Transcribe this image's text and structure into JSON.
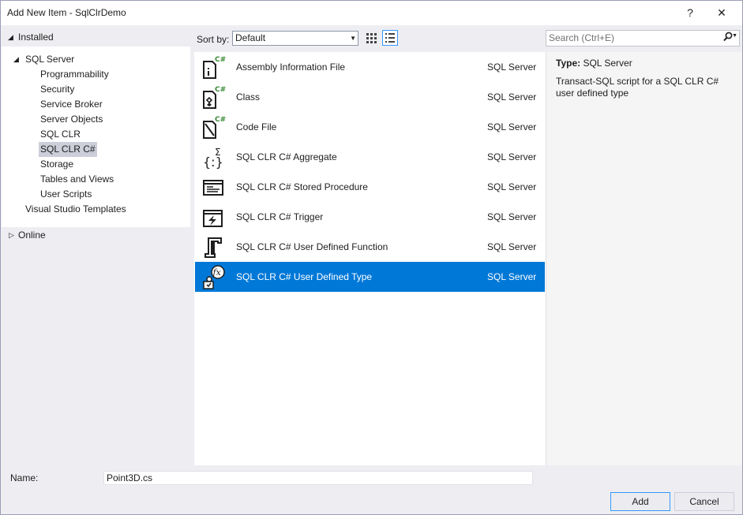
{
  "window": {
    "title": "Add New Item - SqlClrDemo",
    "help_glyph": "?",
    "close_glyph": "✕"
  },
  "left": {
    "installed_label": "Installed",
    "tree": {
      "root": "SQL Server",
      "children": [
        "Programmability",
        "Security",
        "Service Broker",
        "Server Objects",
        "SQL CLR",
        "SQL CLR C#",
        "Storage",
        "Tables and Views",
        "User Scripts"
      ],
      "selected": "SQL CLR C#",
      "sibling": "Visual Studio Templates"
    },
    "online_label": "Online"
  },
  "toolbar": {
    "sort_label": "Sort by:",
    "sort_value": "Default",
    "view_small_icons": "grid-view-icon",
    "view_list": "list-view-icon"
  },
  "search": {
    "placeholder": "Search (Ctrl+E)"
  },
  "items": [
    {
      "name": "Assembly Information File",
      "category": "SQL Server",
      "icon": "assembly-info-file-icon"
    },
    {
      "name": "Class",
      "category": "SQL Server",
      "icon": "class-icon"
    },
    {
      "name": "Code File",
      "category": "SQL Server",
      "icon": "code-file-icon"
    },
    {
      "name": "SQL CLR C# Aggregate",
      "category": "SQL Server",
      "icon": "aggregate-icon"
    },
    {
      "name": "SQL CLR C# Stored Procedure",
      "category": "SQL Server",
      "icon": "stored-procedure-icon"
    },
    {
      "name": "SQL CLR C# Trigger",
      "category": "SQL Server",
      "icon": "trigger-icon"
    },
    {
      "name": "SQL CLR C# User Defined Function",
      "category": "SQL Server",
      "icon": "user-defined-function-icon"
    },
    {
      "name": "SQL CLR C# User Defined Type",
      "category": "SQL Server",
      "icon": "user-defined-type-icon",
      "selected": true
    }
  ],
  "details": {
    "type_label": "Type:",
    "type_value": "SQL Server",
    "description": "Transact-SQL script for a SQL CLR C# user defined type"
  },
  "footer": {
    "name_label": "Name:",
    "name_value": "Point3D.cs",
    "add_label": "Add",
    "cancel_label": "Cancel"
  },
  "colors": {
    "selection": "#0078d7",
    "tree_selection": "#ccceda",
    "dialog_bg": "#eeeef2",
    "badge_green": "#388a34"
  }
}
